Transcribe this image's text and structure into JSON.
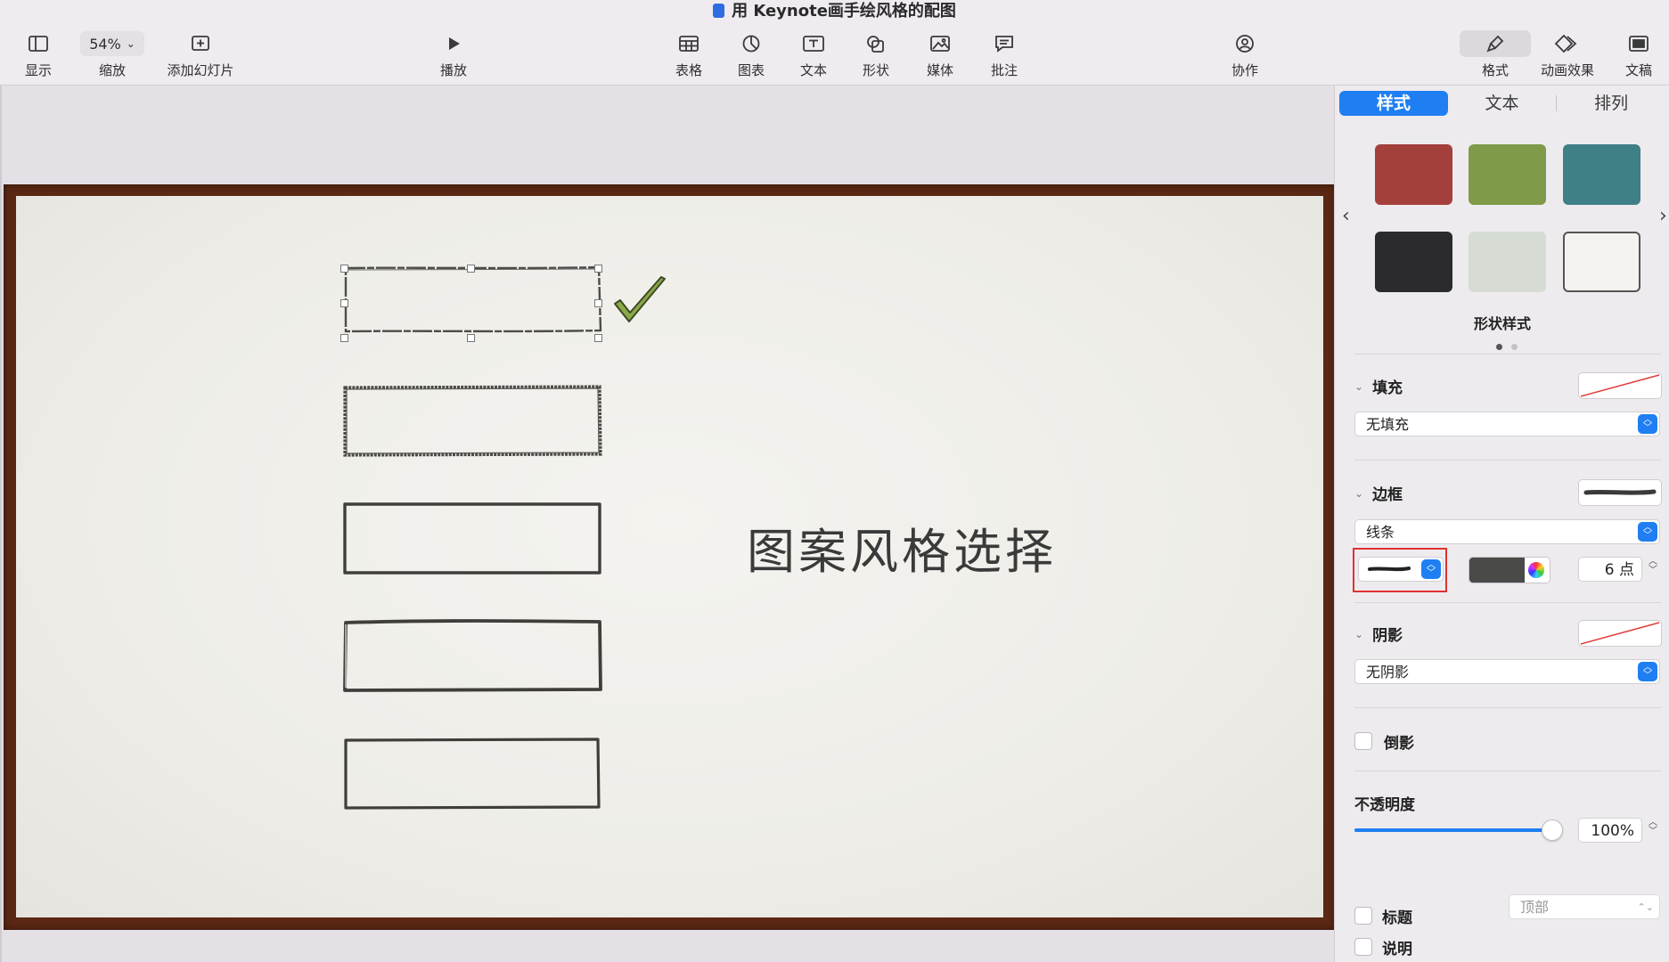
{
  "window": {
    "title": "用 Keynote画手绘风格的配图"
  },
  "toolbar": {
    "view_label": "显示",
    "zoom_value": "54%",
    "zoom_label": "缩放",
    "add_slide_label": "添加幻灯片",
    "play_label": "播放",
    "table_label": "表格",
    "chart_label": "图表",
    "text_label": "文本",
    "shape_label": "形状",
    "media_label": "媒体",
    "comment_label": "批注",
    "collaborate_label": "协作",
    "format_label": "格式",
    "animate_label": "动画效果",
    "document_label": "文稿"
  },
  "slide": {
    "heading": "图案风格选择",
    "check_color": "#8aa94a",
    "frame_color": "#5a2814"
  },
  "inspector": {
    "tabs": [
      "样式",
      "文本",
      "排列"
    ],
    "swatch_colors": [
      "#a4403c",
      "#7f9a48",
      "#3f7f86",
      "#2b2b2e",
      "#d6dcd4",
      "#f4f3f1"
    ],
    "shape_styles_caption": "形状样式",
    "fill": {
      "title": "填充",
      "value": "无填充"
    },
    "border": {
      "title": "边框",
      "value": "线条",
      "width_value": "6 点",
      "color": "#4a4a48"
    },
    "shadow": {
      "title": "阴影",
      "value": "无阴影"
    },
    "reflection_label": "倒影",
    "opacity": {
      "title": "不透明度",
      "value": "100%",
      "fraction": 1.0
    },
    "title_checkbox_label": "标题",
    "title_position_value": "顶部",
    "caption_checkbox_label": "说明",
    "accent_color": "#1f7ff2"
  }
}
